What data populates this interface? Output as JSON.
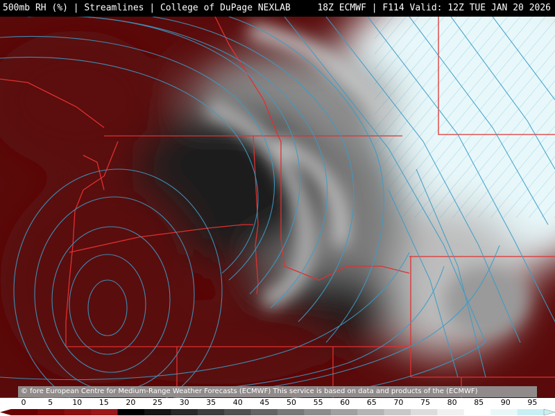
{
  "header": {
    "left": "500mb RH (%) | Streamlines | College of DuPage NEXLAB",
    "right": "18Z ECMWF | F114 Valid: 12Z TUE JAN 20 2026"
  },
  "credit": "© fore European Centre for Medium-Range Weather Forecasts (ECMWF)  This service is based on data and products of the (ECMWF)",
  "legend": {
    "ticks": [
      "0",
      "5",
      "10",
      "15",
      "20",
      "25",
      "30",
      "35",
      "40",
      "45",
      "50",
      "55",
      "60",
      "65",
      "70",
      "75",
      "80",
      "85",
      "90",
      "95"
    ],
    "colors": [
      "#6b0000",
      "#7a0808",
      "#8a1010",
      "#9a1818",
      "#000000",
      "#141414",
      "#282828",
      "#3c3c3c",
      "#505050",
      "#646464",
      "#787878",
      "#8c8c8c",
      "#a0a0a0",
      "#b4b4b4",
      "#c8c8c8",
      "#dcdcdc",
      "#f0f0f0",
      "#ffffff",
      "#e8f8f8",
      "#c8f0f4"
    ]
  },
  "colors": {
    "streamline": "#3a9cc8",
    "border": "#e03030",
    "dry": "#5a0a0a",
    "moist": "#d6f6f8"
  }
}
